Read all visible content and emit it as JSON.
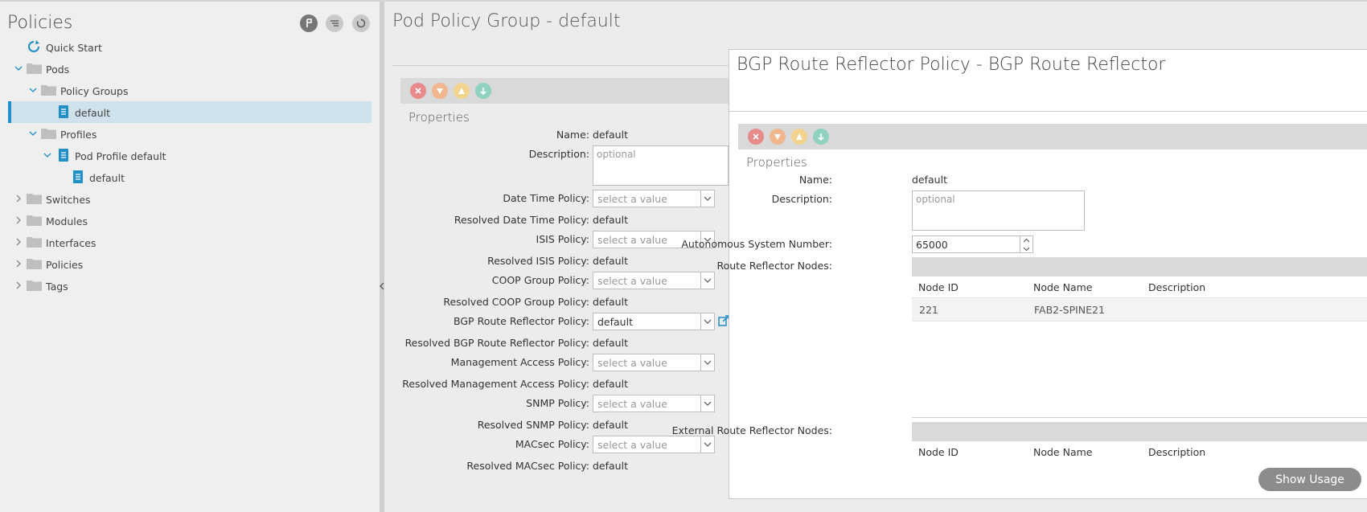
{
  "sidebar": {
    "title": "Policies",
    "buttons": [
      {
        "name": "filter-icon"
      },
      {
        "name": "list-filter-icon"
      },
      {
        "name": "refresh-icon"
      }
    ],
    "tree": {
      "quick_start": "Quick Start",
      "pods": "Pods",
      "policy_groups": "Policy Groups",
      "policy_group_default": "default",
      "profiles": "Profiles",
      "pod_profile_default": "Pod Profile default",
      "pod_profile_child_default": "default",
      "switches": "Switches",
      "modules": "Modules",
      "interfaces": "Interfaces",
      "policies": "Policies",
      "tags": "Tags"
    }
  },
  "main": {
    "title": "Pod Policy Group - default",
    "properties_heading": "Properties",
    "name_label": "Name:",
    "name_value": "default",
    "description_label": "Description:",
    "description_placeholder": "optional",
    "fields": {
      "date_time_label": "Date Time Policy:",
      "date_time_value": "select a value",
      "resolved_date_time_label": "Resolved Date Time Policy:",
      "resolved_date_time_value": "default",
      "isis_label": "ISIS Policy:",
      "isis_value": "select a value",
      "resolved_isis_label": "Resolved ISIS Policy:",
      "resolved_isis_value": "default",
      "coop_label": "COOP Group Policy:",
      "coop_value": "select a value",
      "resolved_coop_label": "Resolved COOP Group Policy:",
      "resolved_coop_value": "default",
      "bgp_label": "BGP Route Reflector Policy:",
      "bgp_value": "default",
      "resolved_bgp_label": "Resolved BGP Route Reflector Policy:",
      "resolved_bgp_value": "default",
      "mgmt_label": "Management Access Policy:",
      "mgmt_value": "select a value",
      "resolved_mgmt_label": "Resolved Management Access Policy:",
      "resolved_mgmt_value": "default",
      "snmp_label": "SNMP Policy:",
      "snmp_value": "select a value",
      "resolved_snmp_label": "Resolved SNMP Policy:",
      "resolved_snmp_value": "default",
      "macsec_label": "MACsec Policy:",
      "macsec_value": "select a value",
      "resolved_macsec_label": "Resolved MACsec Policy:",
      "resolved_macsec_value": "default"
    }
  },
  "overlay": {
    "title": "BGP Route Reflector Policy - BGP Route Reflector",
    "properties_heading": "Properties",
    "name_label": "Name:",
    "name_value": "default",
    "description_label": "Description:",
    "description_placeholder": "optional",
    "asn_label": "Autonomous System Number:",
    "asn_value": "65000",
    "rr_nodes_label": "Route Reflector Nodes:",
    "columns": [
      "Node ID",
      "Node Name",
      "Description"
    ],
    "rows": [
      {
        "node_id": "221",
        "node_name": "FAB2-SPINE21",
        "description": ""
      }
    ],
    "ext_rr_nodes_label": "External Route Reflector Nodes:",
    "ext_columns": [
      "Node ID",
      "Node Name",
      "Description"
    ],
    "show_usage_label": "Show Usage"
  },
  "colors": {
    "accent": "#1f8fc5",
    "toolbar_red": "#e88a8a",
    "toolbar_orange": "#f0b78e",
    "toolbar_yellow": "#f1d38e",
    "toolbar_green": "#8fd2c0"
  }
}
